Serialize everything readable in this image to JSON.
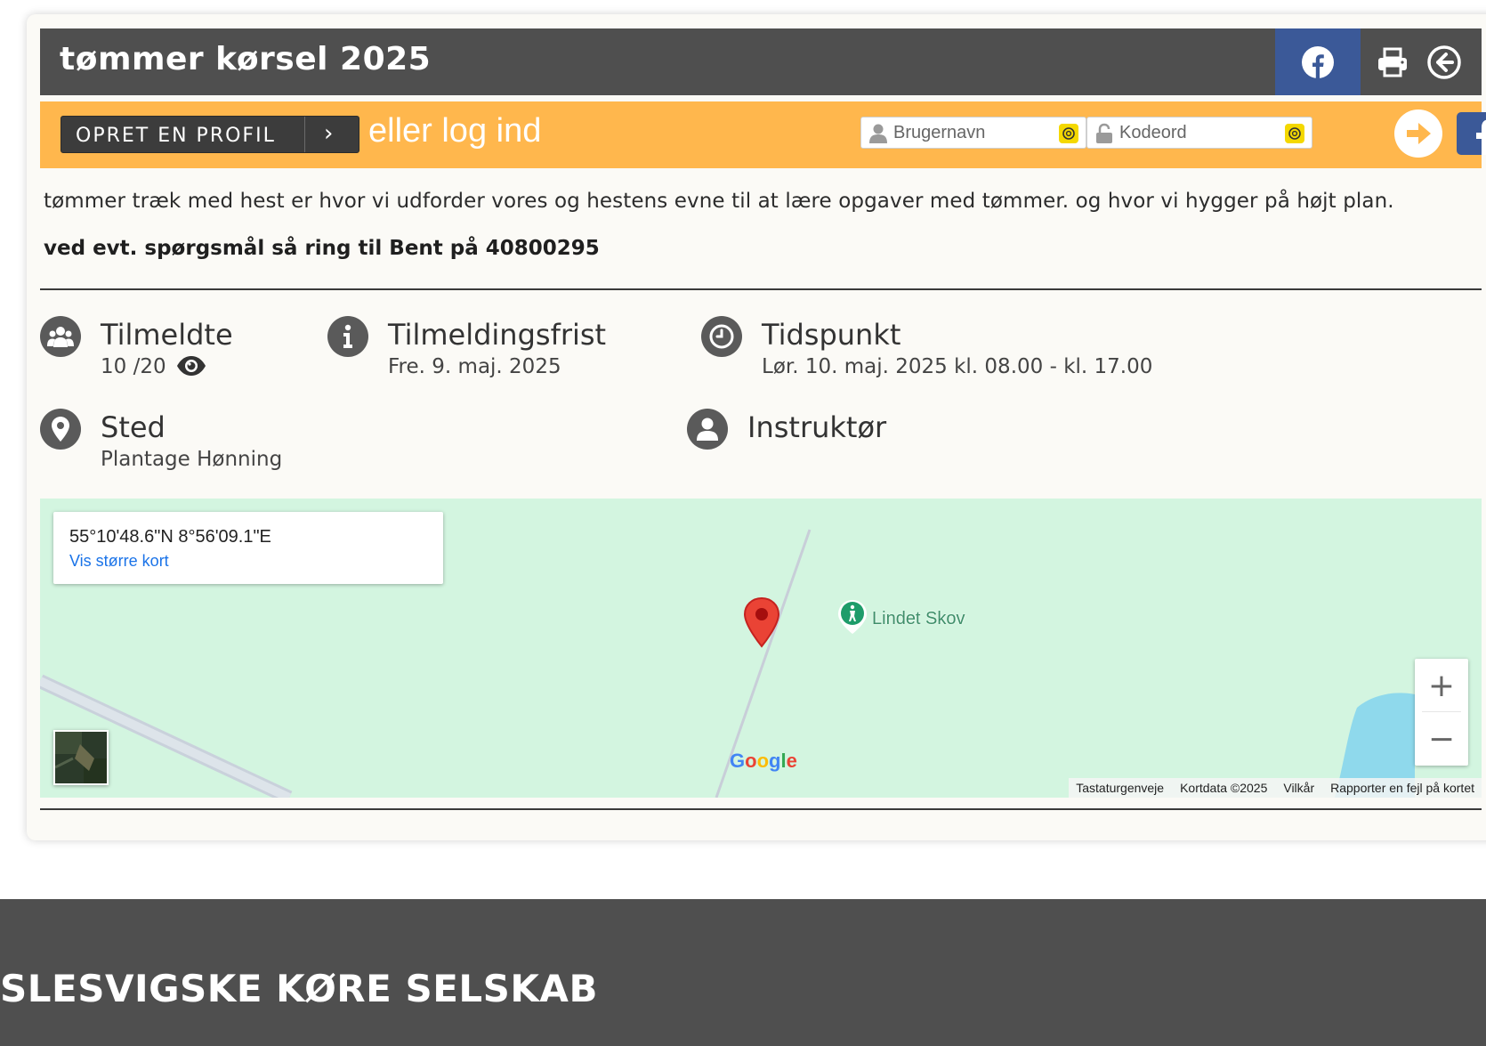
{
  "header": {
    "title": "tømmer kørsel 2025",
    "colors": {
      "bar": "#4f4f4f",
      "facebook": "#3b5998"
    },
    "icons": [
      "facebook-icon",
      "print-icon",
      "back-arrow-icon"
    ]
  },
  "loginbar": {
    "create_profile_label": "OPRET EN PROFIL",
    "or_login_text": "eller log ind",
    "username_placeholder": "Brugernavn",
    "password_placeholder": "Kodeord",
    "color": "#ffb74d"
  },
  "event": {
    "description": "tømmer træk med hest er hvor vi udforder vores og hestens evne til at lære opgaver med tømmer. og hvor vi hygger på højt plan.",
    "contact": "ved evt. spørgsmål så ring til Bent på 40800295"
  },
  "info": {
    "registered": {
      "heading": "Tilmeldte",
      "value": "10 /20"
    },
    "deadline": {
      "heading": "Tilmeldingsfrist",
      "value": "Fre. 9. maj. 2025"
    },
    "time": {
      "heading": "Tidspunkt",
      "value": "Lør. 10. maj. 2025 kl. 08.00 - kl. 17.00"
    },
    "place": {
      "heading": "Sted",
      "value": "Plantage Hønning"
    },
    "instructor": {
      "heading": "Instruktør"
    }
  },
  "map": {
    "coordinates": "55°10'48.6\"N 8°56'09.1\"E",
    "larger_map_link": "Vis større kort",
    "poi_label": "Lindet Skov",
    "zoom_in": "+",
    "zoom_out": "−",
    "google_logo": "Google",
    "attribution": [
      "Tastaturgenveje",
      "Kortdata ©2025",
      "Vilkår",
      "Rapporter en fejl på kortet"
    ],
    "colors": {
      "land": "#d3f5e0",
      "water": "#8fd9ec",
      "marker": "#ea4335"
    }
  },
  "footer": {
    "brand": "SLESVIGSKE KØRE SELSKAB"
  }
}
